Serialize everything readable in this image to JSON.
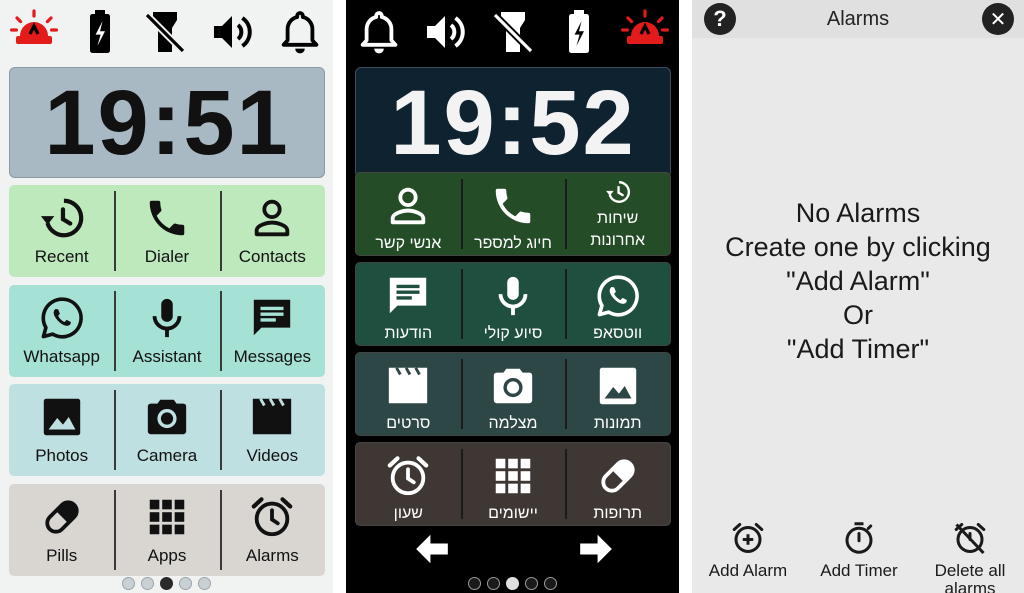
{
  "colors": {
    "siren_red": "#e31b1b",
    "light_row_green": "#bde9bd",
    "light_row_teal": "#a6e1d6",
    "light_row_blue": "#bfe0e1",
    "light_row_grey": "#d9d6d2",
    "dark_row_green": "#244d27",
    "dark_row_teal": "#1f4f3f",
    "dark_row_slate": "#2c4745",
    "dark_row_brown": "#3f3734"
  },
  "light_screen": {
    "clock": "19:51",
    "status_icons": [
      "siren-icon",
      "battery-charging-icon",
      "flashlight-off-icon",
      "volume-icon",
      "bell-icon"
    ],
    "rows": [
      [
        {
          "label": "Recent",
          "icon": "history-icon"
        },
        {
          "label": "Dialer",
          "icon": "phone-icon"
        },
        {
          "label": "Contacts",
          "icon": "person-icon"
        }
      ],
      [
        {
          "label": "Whatsapp",
          "icon": "whatsapp-icon"
        },
        {
          "label": "Assistant",
          "icon": "microphone-icon"
        },
        {
          "label": "Messages",
          "icon": "message-icon"
        }
      ],
      [
        {
          "label": "Photos",
          "icon": "image-icon"
        },
        {
          "label": "Camera",
          "icon": "camera-icon"
        },
        {
          "label": "Videos",
          "icon": "clapperboard-icon"
        }
      ],
      [
        {
          "label": "Pills",
          "icon": "pill-icon"
        },
        {
          "label": "Apps",
          "icon": "apps-grid-icon"
        },
        {
          "label": "Alarms",
          "icon": "alarm-clock-icon"
        }
      ]
    ],
    "pages": {
      "count": 5,
      "current": 3
    }
  },
  "dark_screen": {
    "clock": "19:52",
    "status_icons": [
      "bell-icon",
      "volume-icon",
      "flashlight-off-icon",
      "battery-charging-icon",
      "siren-icon"
    ],
    "rows": [
      [
        {
          "label": "אנשי קשר",
          "icon": "person-icon"
        },
        {
          "label": "חיוג למספר",
          "icon": "phone-icon"
        },
        {
          "label": "שיחות\nאחרונות",
          "icon": "history-icon"
        }
      ],
      [
        {
          "label": "הודעות",
          "icon": "message-icon"
        },
        {
          "label": "סיוע קולי",
          "icon": "microphone-icon"
        },
        {
          "label": "ווטסאפ",
          "icon": "whatsapp-icon"
        }
      ],
      [
        {
          "label": "סרטים",
          "icon": "clapperboard-icon"
        },
        {
          "label": "מצלמה",
          "icon": "camera-icon"
        },
        {
          "label": "תמונות",
          "icon": "image-icon"
        }
      ],
      [
        {
          "label": "שעון",
          "icon": "alarm-clock-icon"
        },
        {
          "label": "יישומים",
          "icon": "apps-grid-icon"
        },
        {
          "label": "תרופות",
          "icon": "pill-icon"
        }
      ]
    ],
    "nav": {
      "back_icon": "arrow-left-icon",
      "forward_icon": "arrow-right-icon"
    },
    "pages": {
      "count": 5,
      "current": 3
    }
  },
  "alarms_screen": {
    "header": {
      "title": "Alarms",
      "help_icon": "help-icon",
      "close_icon": "close-icon"
    },
    "empty_message": [
      "No Alarms",
      "Create one by clicking",
      "\"Add Alarm\"",
      "Or",
      "\"Add Timer\""
    ],
    "actions": [
      {
        "label": "Add Alarm",
        "icon": "add-alarm-icon"
      },
      {
        "label": "Add Timer",
        "icon": "timer-icon"
      },
      {
        "label": "Delete all alarms",
        "icon": "alarm-off-icon"
      }
    ]
  }
}
